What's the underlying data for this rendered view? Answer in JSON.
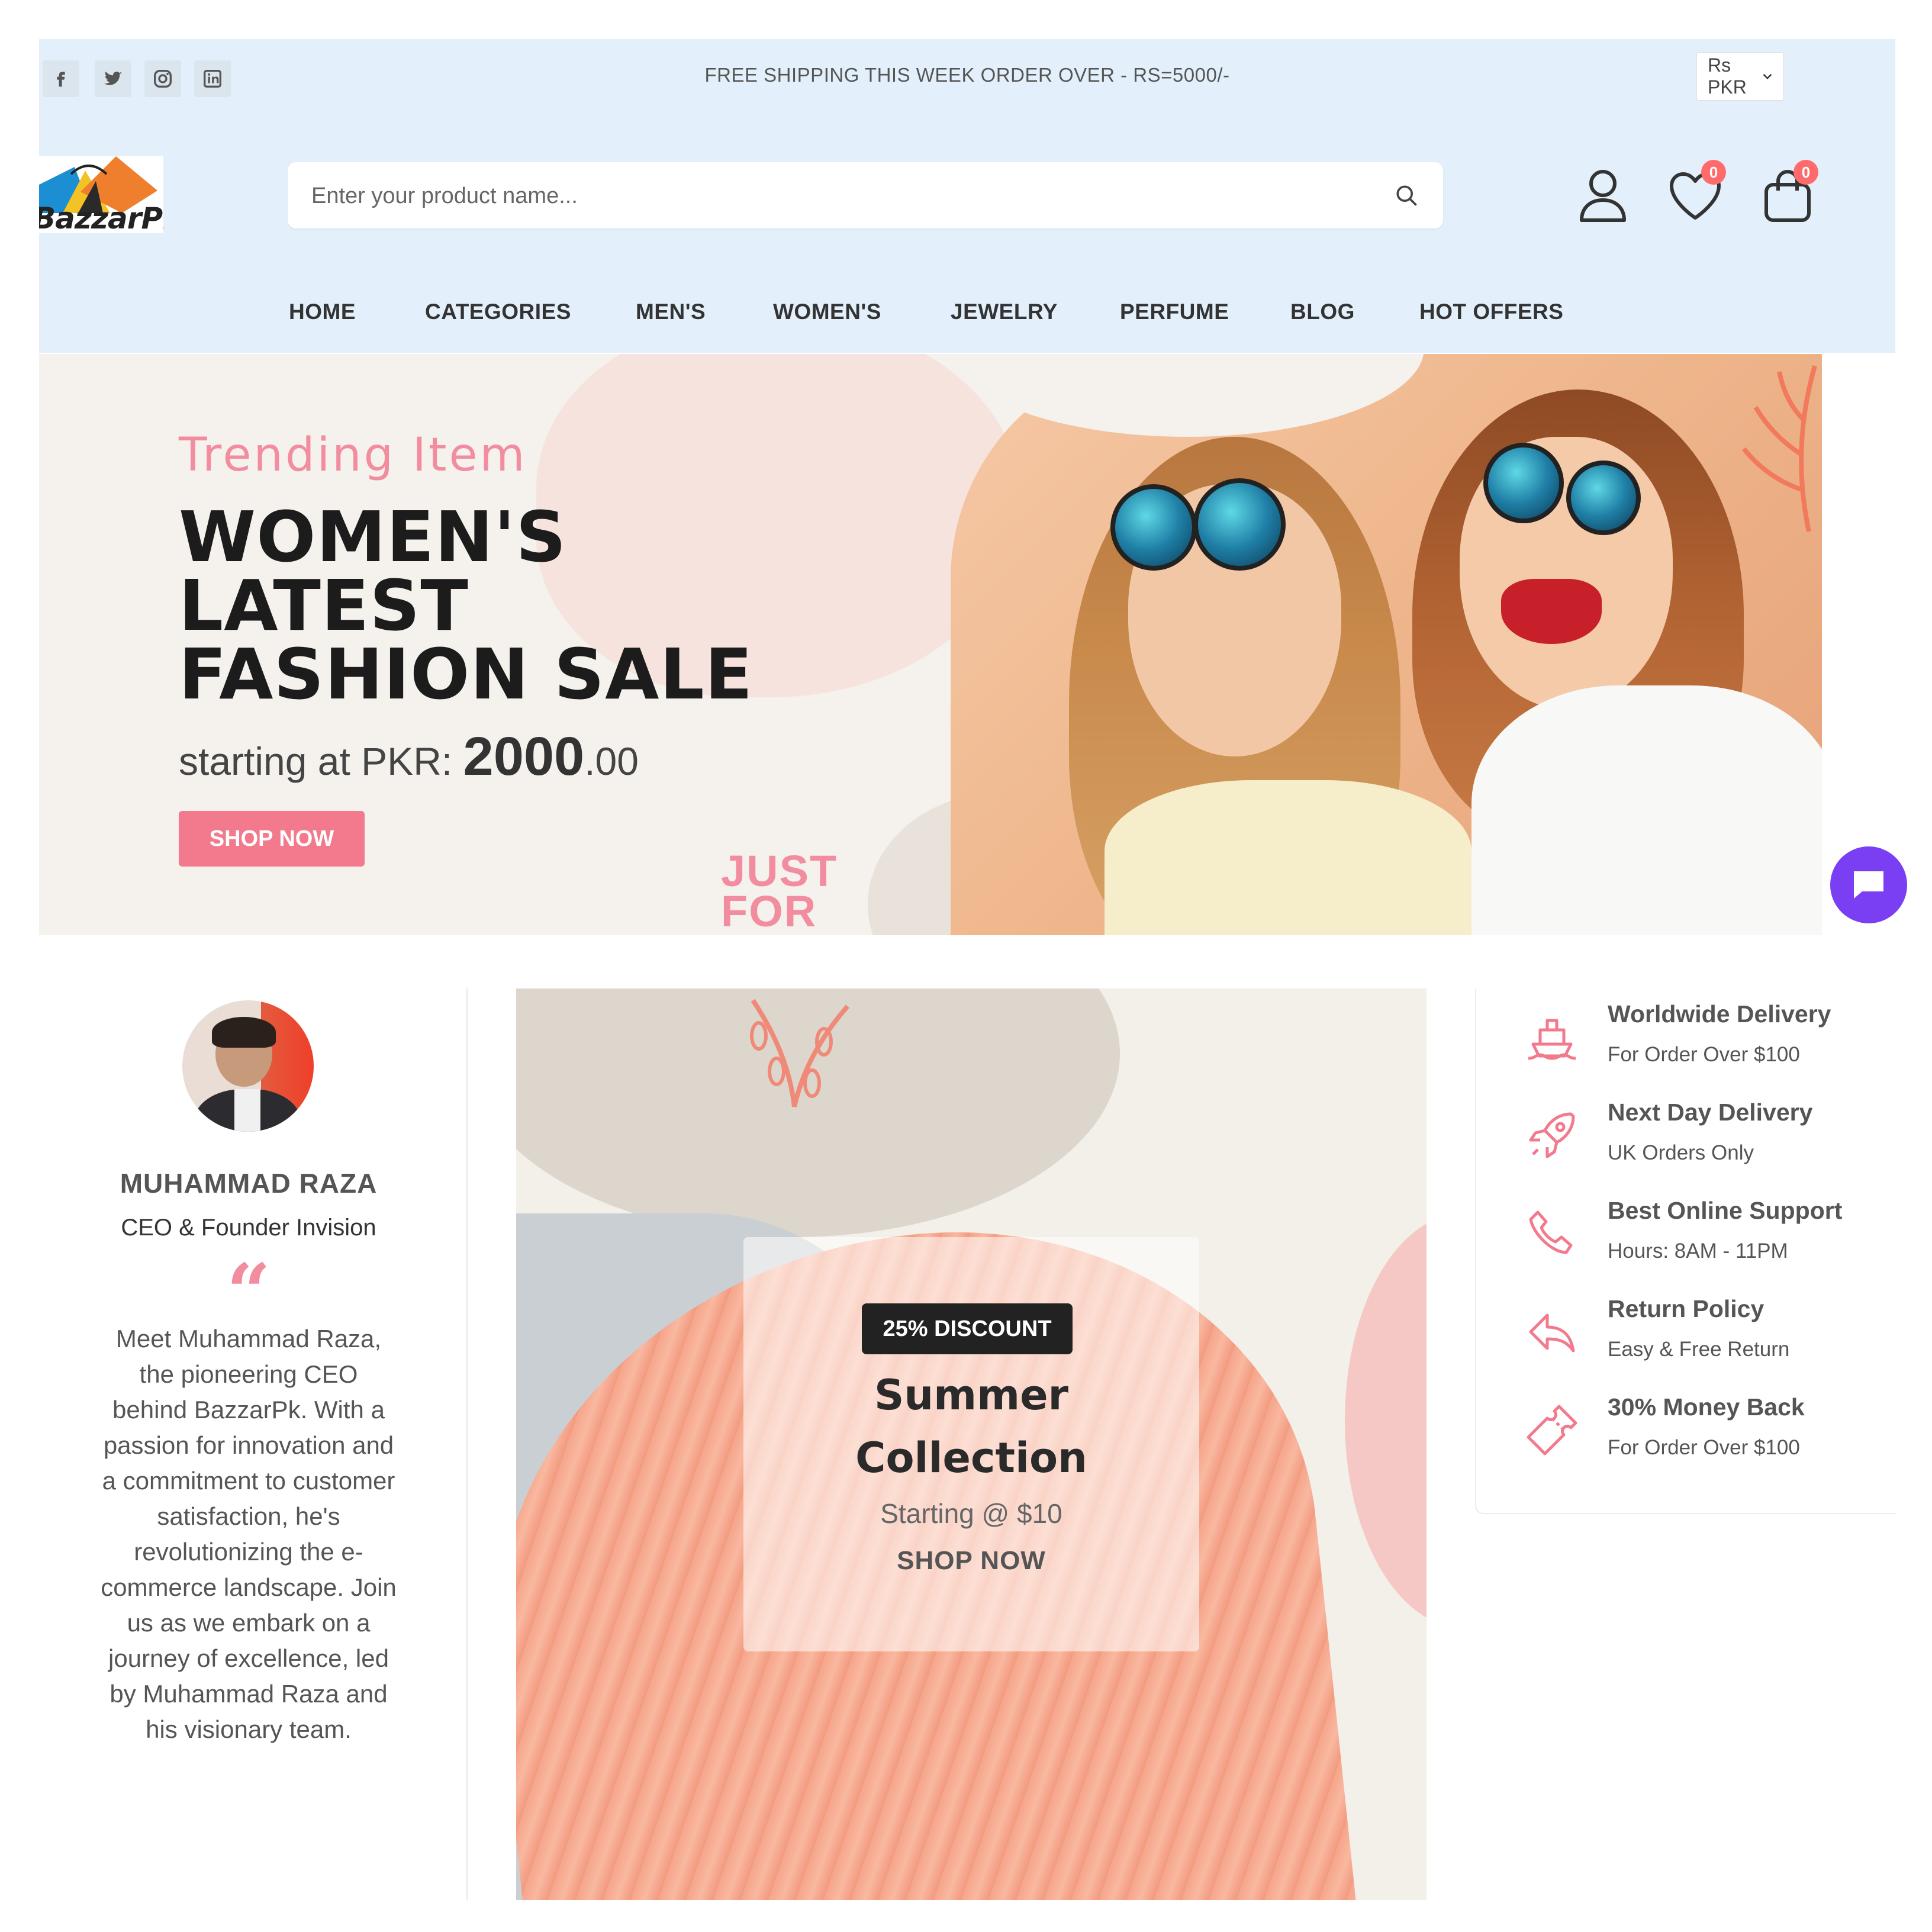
{
  "topbar": {
    "social": [
      "facebook-icon",
      "twitter-icon",
      "instagram-icon",
      "linkedin-icon"
    ],
    "shipping_notice": "FREE SHIPPING THIS WEEK ORDER OVER - RS=5000/-",
    "currency": "Rs PKR"
  },
  "header": {
    "logo_text": "BazzarPK",
    "search_placeholder": "Enter your product name...",
    "wishlist_count": "0",
    "cart_count": "0"
  },
  "nav": {
    "items": [
      "HOME",
      "CATEGORIES",
      "MEN'S",
      "WOMEN'S",
      "JEWELRY",
      "PERFUME",
      "BLOG",
      "HOT OFFERS"
    ]
  },
  "hero": {
    "subtitle": "Trending Item",
    "title_lines": [
      "WOMEN'S",
      "LATEST",
      "FASHION SALE"
    ],
    "price_prefix": "starting at PKR: ",
    "price_int": "2000",
    "price_dec": ".00",
    "button": "SHOP NOW",
    "decor_text": [
      "JUST",
      "FOR"
    ]
  },
  "testimonial": {
    "name": "MUHAMMAD RAZA",
    "role": "CEO & Founder Invision",
    "quote_mark": "“",
    "bio": "Meet Muhammad Raza, the pioneering CEO behind BazzarPk. With a passion for innovation and a commitment to customer satisfaction, he's revolutionizing the e-commerce landscape. Join us as we embark on a journey of excellence, led by Muhammad Raza and his visionary team."
  },
  "collection": {
    "badge": "25% DISCOUNT",
    "title_lines": [
      "Summer",
      "Collection"
    ],
    "subtitle": "Starting @ $10",
    "button": "SHOP NOW"
  },
  "services": [
    {
      "icon": "ship-icon",
      "title": "Worldwide Delivery",
      "subtitle": "For Order Over $100"
    },
    {
      "icon": "rocket-icon",
      "title": "Next Day Delivery",
      "subtitle": "UK Orders Only"
    },
    {
      "icon": "phone-icon",
      "title": "Best Online Support",
      "subtitle": "Hours: 8AM - 11PM"
    },
    {
      "icon": "return-arrow-icon",
      "title": "Return Policy",
      "subtitle": "Easy & Free Return"
    },
    {
      "icon": "ticket-icon",
      "title": "30% Money Back",
      "subtitle": "For Order Over $100"
    }
  ],
  "colors": {
    "accent_pink": "#f27a8c",
    "header_bg": "#e3f0fb",
    "chat_button": "#7a3ff2",
    "badge_red": "#ff6b6b"
  }
}
